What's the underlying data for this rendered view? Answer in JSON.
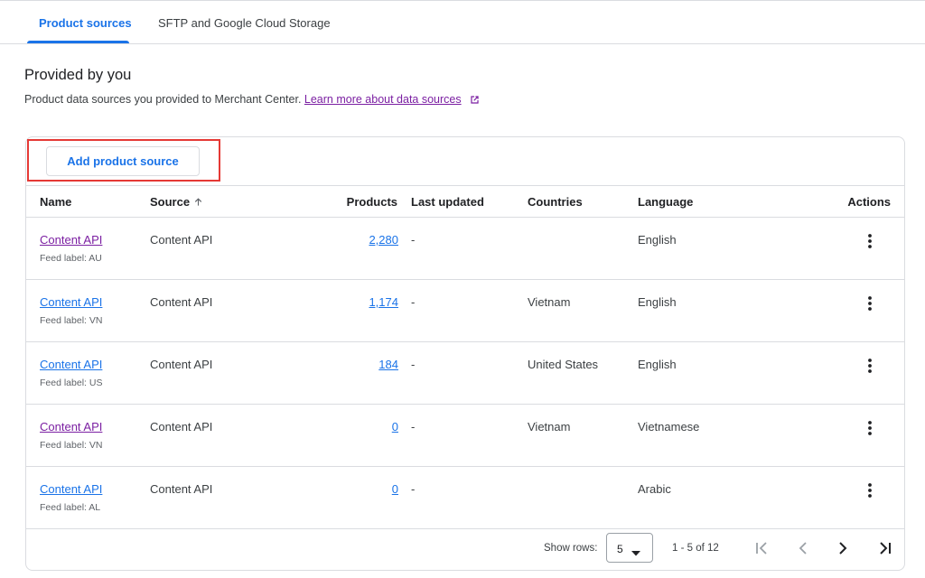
{
  "tabs": [
    {
      "label": "Product sources",
      "active": true
    },
    {
      "label": "SFTP and Google Cloud Storage",
      "active": false
    }
  ],
  "section": {
    "title": "Provided by you",
    "description": "Product data sources you provided to Merchant Center.",
    "learn_more": "Learn more about data sources"
  },
  "toolbar": {
    "add_label": "Add product source"
  },
  "table": {
    "columns": [
      "Name",
      "Source",
      "Products",
      "Last updated",
      "Countries",
      "Language",
      "Actions"
    ],
    "rows": [
      {
        "name": "Content API",
        "feed_label": "Feed label: AU",
        "source": "Content API",
        "products": "2,280",
        "last_updated": "-",
        "countries": "",
        "language": "English"
      },
      {
        "name": "Content API",
        "feed_label": "Feed label: VN",
        "source": "Content API",
        "products": "1,174",
        "last_updated": "-",
        "countries": "Vietnam",
        "language": "English"
      },
      {
        "name": "Content API",
        "feed_label": "Feed label: US",
        "source": "Content API",
        "products": "184",
        "last_updated": "-",
        "countries": "United States",
        "language": "English"
      },
      {
        "name": "Content API",
        "feed_label": "Feed label: VN",
        "source": "Content API",
        "products": "0",
        "last_updated": "-",
        "countries": "Vietnam",
        "language": "Vietnamese"
      },
      {
        "name": "Content API",
        "feed_label": "Feed label: AL",
        "source": "Content API",
        "products": "0",
        "last_updated": "-",
        "countries": "",
        "language": "Arabic"
      }
    ]
  },
  "pagination": {
    "show_rows_label": "Show rows:",
    "rows_value": "5",
    "range": "1 - 5 of 12"
  },
  "colors": {
    "accent": "#1a73e8",
    "visited_link": "#7b1fa2",
    "highlight": "#e53935"
  },
  "icons": [
    "open-in-new-icon",
    "arrow-up-icon",
    "more-vert-icon",
    "caret-down-icon",
    "first-page-icon",
    "chevron-left-icon",
    "chevron-right-icon",
    "last-page-icon"
  ]
}
